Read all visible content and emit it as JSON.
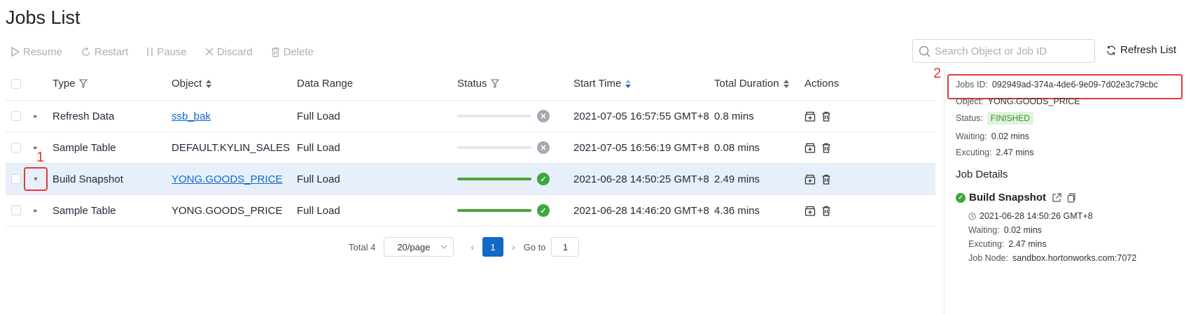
{
  "page": {
    "title": "Jobs List"
  },
  "toolbar": {
    "resume": "Resume",
    "restart": "Restart",
    "pause": "Pause",
    "discard": "Discard",
    "delete": "Delete"
  },
  "search": {
    "placeholder": "Search Object or Job ID"
  },
  "refresh_label": "Refresh List",
  "table": {
    "headers": {
      "type": "Type",
      "object": "Object",
      "data_range": "Data Range",
      "status": "Status",
      "start_time": "Start Time",
      "total_duration": "Total Duration",
      "actions": "Actions"
    },
    "rows": [
      {
        "type": "Refresh Data",
        "object": "ssb_bak",
        "data_range": "Full Load",
        "status": "discarded",
        "progress": 0,
        "start_time": "2021-07-05 16:57:55 GMT+8",
        "duration": "0.8 mins"
      },
      {
        "type": "Sample Table",
        "object": "DEFAULT.KYLIN_SALES",
        "data_range": "Full Load",
        "status": "discarded",
        "progress": 0,
        "start_time": "2021-07-05 16:56:19 GMT+8",
        "duration": "0.08 mins"
      },
      {
        "type": "Build Snapshot",
        "object": "YONG.GOODS_PRICE",
        "data_range": "Full Load",
        "status": "finished",
        "progress": 100,
        "start_time": "2021-06-28 14:50:25 GMT+8",
        "duration": "2.49 mins"
      },
      {
        "type": "Sample Table",
        "object": "YONG.GOODS_PRICE",
        "data_range": "Full Load",
        "status": "finished",
        "progress": 100,
        "start_time": "2021-06-28 14:46:20 GMT+8",
        "duration": "4.36 mins"
      }
    ]
  },
  "pagination": {
    "total": "Total 4",
    "page_size": "20/page",
    "current_page": "1",
    "goto_label": "Go to",
    "goto_value": "1"
  },
  "panel": {
    "job_id_label": "Jobs ID:",
    "job_id": "092949ad-374a-4de6-9e09-7d02e3c79cbc",
    "object_label": "Object:",
    "object": "YONG.GOODS_PRICE",
    "status_label": "Status:",
    "status": "FINISHED",
    "waiting_label": "Waiting:",
    "waiting": "0.02 mins",
    "exec_label": "Excuting:",
    "exec": "2.47 mins",
    "details_title": "Job Details",
    "step": {
      "name": "Build Snapshot",
      "time": "2021-06-28 14:50:26 GMT+8",
      "waiting_label": "Waiting:",
      "waiting": "0.02 mins",
      "exec_label": "Excuting:",
      "exec": "2.47 mins",
      "node_label": "Job Node:",
      "node": "sandbox.hortonworks.com:7072"
    }
  },
  "annotations": {
    "one": "1",
    "two": "2"
  },
  "colors": {
    "accent": "#1268c6",
    "success": "#3aa93a",
    "highlight": "#e53935",
    "selected_row": "#e7f0fa"
  },
  "icons": [
    "play-icon",
    "restart-icon",
    "pause-icon",
    "close-icon",
    "trash-icon",
    "search-icon",
    "refresh-icon",
    "filter-icon",
    "sort-icon",
    "chevron-icon",
    "check-circle-icon",
    "x-circle-icon",
    "clock-icon",
    "external-link-icon",
    "copy-icon"
  ]
}
